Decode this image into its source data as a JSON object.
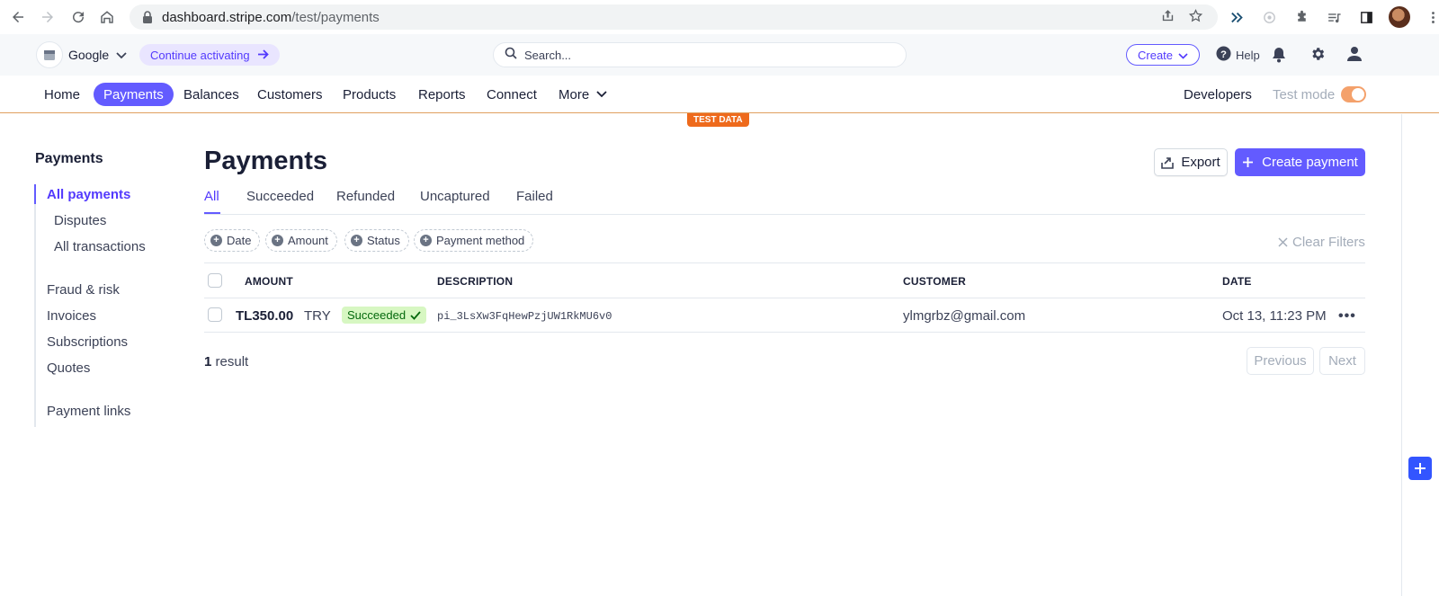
{
  "browser": {
    "url_host": "dashboard.stripe.com",
    "url_path": "/test/payments"
  },
  "topbar": {
    "account_name": "Google",
    "activate_label": "Continue activating",
    "search_placeholder": "Search...",
    "create_label": "Create",
    "help_label": "Help"
  },
  "mainnav": {
    "items": [
      "Home",
      "Payments",
      "Balances",
      "Customers",
      "Products",
      "Reports",
      "Connect",
      "More"
    ],
    "active": "Payments",
    "developers_label": "Developers",
    "test_mode_label": "Test mode",
    "test_mode_on": true,
    "test_data_badge": "TEST DATA"
  },
  "sidebar": {
    "title": "Payments",
    "items": [
      "All payments",
      "Disputes",
      "All transactions",
      "Fraud & risk",
      "Invoices",
      "Subscriptions",
      "Quotes",
      "Payment links"
    ],
    "active": "All payments"
  },
  "page": {
    "title": "Payments",
    "export_label": "Export",
    "create_payment_label": "Create payment",
    "tabs": [
      "All",
      "Succeeded",
      "Refunded",
      "Uncaptured",
      "Failed"
    ],
    "active_tab": "All",
    "filters": [
      "Date",
      "Amount",
      "Status",
      "Payment method"
    ],
    "clear_filters_label": "Clear Filters"
  },
  "table": {
    "columns": [
      "AMOUNT",
      "DESCRIPTION",
      "CUSTOMER",
      "DATE"
    ],
    "rows": [
      {
        "amount": "TL350.00",
        "currency": "TRY",
        "status": "Succeeded",
        "description": "pi_3LsXw3FqHewPzjUW1RkMU6v0",
        "customer": "ylmgrbz@gmail.com",
        "date": "Oct 13, 11:23 PM"
      }
    ]
  },
  "footer": {
    "result_count": "1",
    "result_label": "result",
    "previous_label": "Previous",
    "next_label": "Next"
  },
  "colors": {
    "accent": "#635bff",
    "success_bg": "#d7f7c2",
    "success_text": "#05690d",
    "test_badge": "#ee6a1c"
  }
}
